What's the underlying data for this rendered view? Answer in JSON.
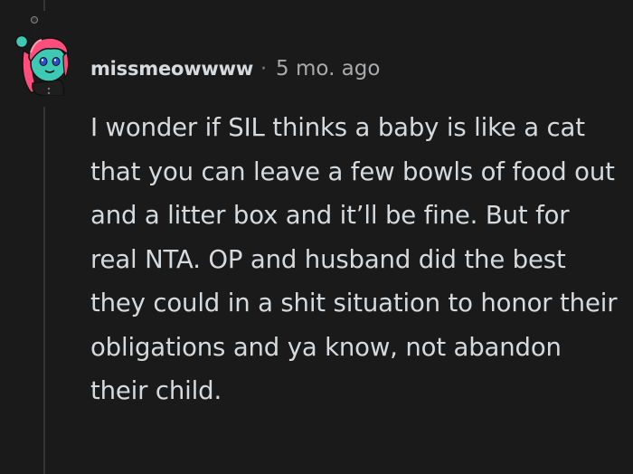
{
  "comment": {
    "author": "missmeowwww",
    "separator": "·",
    "age": "5 mo. ago",
    "body": "I wonder if SIL thinks a baby is like a cat that you can leave a few bowls of food out and a litter box and it’ll be fine. But for real NTA. OP and husband did the best they could in a shit situation to honor their obligations and ya know, not abandon their child."
  },
  "colors": {
    "background": "#1a1a1b",
    "text": "#d7dadc",
    "muted": "#818384",
    "avatar_hair": "#ff4d7d",
    "avatar_skin": "#3ec9b4"
  },
  "icons": {
    "avatar": "snoo-avatar"
  }
}
